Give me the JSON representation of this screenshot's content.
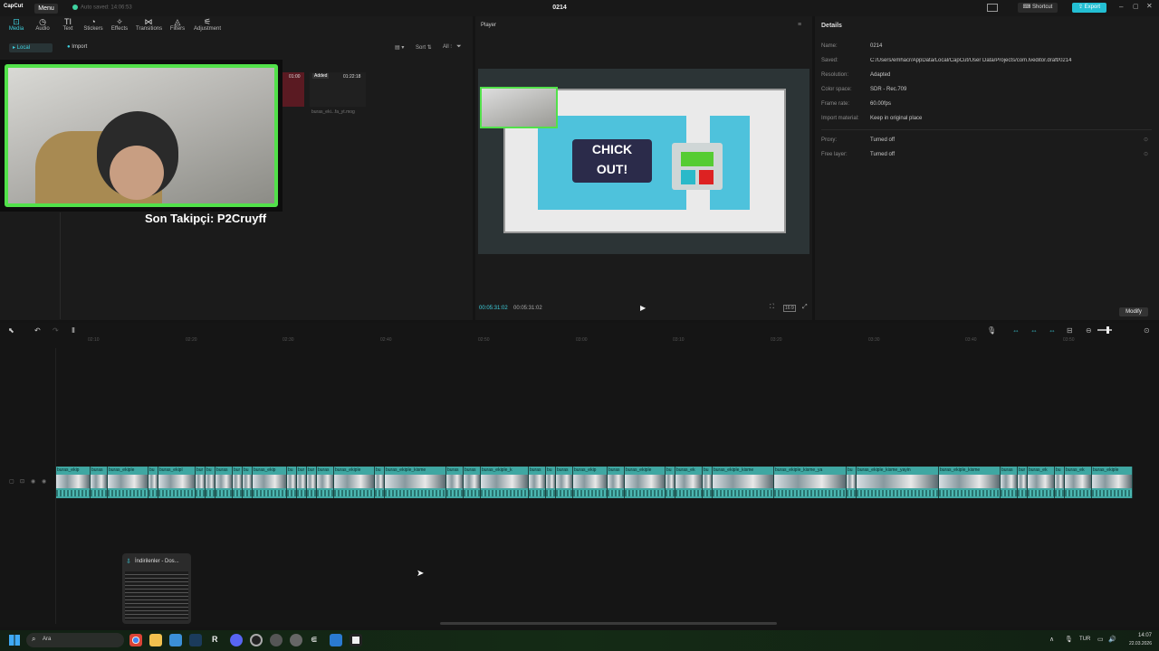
{
  "app": {
    "name": "CapCut",
    "menu_label": "Menu",
    "autosave": "Auto saved: 14:06:53",
    "project_title": "0214",
    "shortcut_label": "Shortcut",
    "export_label": "Export"
  },
  "toolbar": {
    "tabs": [
      {
        "label": "Media",
        "icon": "media-icon"
      },
      {
        "label": "Audio",
        "icon": "audio-icon"
      },
      {
        "label": "Text",
        "icon": "text-icon"
      },
      {
        "label": "Stickers",
        "icon": "stickers-icon"
      },
      {
        "label": "Effects",
        "icon": "effects-icon"
      },
      {
        "label": "Transitions",
        "icon": "transitions-icon"
      },
      {
        "label": "Filters",
        "icon": "filters-icon"
      },
      {
        "label": "Adjustment",
        "icon": "adjustment-icon"
      }
    ]
  },
  "media": {
    "local_label": "Local",
    "import_label": "Import",
    "sort_label": "Sort",
    "all_label": "All",
    "clip1_time": "01:00",
    "clip2_badge": "Added",
    "clip2_time": "01:22:18",
    "clip2_name": "buras_eki...fa_yt.mog",
    "overlay_text": "Son Takipçi: P2Cruyff"
  },
  "player": {
    "title": "Player",
    "current_time": "00:05:31:02",
    "total_time": "00:05:31:02",
    "ratio_label": "16:9"
  },
  "details": {
    "title": "Details",
    "modify_label": "Modify",
    "rows": [
      {
        "label": "Name:",
        "value": "0214"
      },
      {
        "label": "Saved:",
        "value": "C:/Users/emhacr/AppData/Local/CapCut/User Data/Projects/com.lveditor.draft/0214"
      },
      {
        "label": "Resolution:",
        "value": "Adapted"
      },
      {
        "label": "Color space:",
        "value": "SDR - Rec.709"
      },
      {
        "label": "Frame rate:",
        "value": "60.00fps"
      },
      {
        "label": "Import material:",
        "value": "Keep in original place"
      },
      {
        "label": "Proxy:",
        "value": "Turned off"
      },
      {
        "label": "Free layer:",
        "value": "Turned off"
      }
    ]
  },
  "timeline": {
    "ruler": [
      "02:10",
      "02:20",
      "02:30",
      "02:40",
      "02:50",
      "03:00",
      "03:10",
      "03:20",
      "03:30",
      "03:40",
      "03:50"
    ],
    "clips": [
      "buras_ekip",
      "buras",
      "buras_ekiple",
      "bu",
      "buras_ekipl",
      "bur",
      "bu",
      "buras",
      "bur",
      "bu",
      "buras_ekip",
      "bu",
      "bur",
      "bur",
      "buras",
      "buras_ekiple",
      "bu",
      "buras_ekiple_kisme",
      "buras",
      "buras",
      "buras_ekiple_k",
      "buras",
      "bu",
      "buras",
      "buras_ekip",
      "buras",
      "buras_ekiple",
      "bu",
      "buras_ek",
      "bu",
      "buras_ekiple_kisme",
      "buras_ekiple_kisme_ya",
      "bu",
      "buras_ekiple_kisme_yayin",
      "buras_ekiple_kisme",
      "buras",
      "bur",
      "buras_ek",
      "bu",
      "buras_ek",
      "buras_ekiple"
    ]
  },
  "taskbar": {
    "search_placeholder": "Ara",
    "language": "TUR",
    "time": "14:07",
    "date": "22.03.2026",
    "preview_title": "İndirilenler - Dos..."
  }
}
